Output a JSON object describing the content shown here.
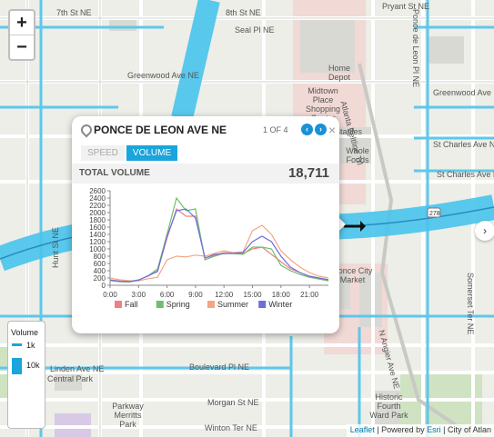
{
  "map": {
    "street_labels": [
      {
        "text": "7th St NE"
      },
      {
        "text": "8th St NE"
      },
      {
        "text": "Pryant St NE"
      },
      {
        "text": "Seal Pl NE"
      },
      {
        "text": "Greenwood Ave NE"
      },
      {
        "text": "Greenwood Ave NE"
      },
      {
        "text": "St Charles Ave NE"
      },
      {
        "text": "St Charles Ave NE"
      },
      {
        "text": "Home Depot"
      },
      {
        "text": "Midtown Place Shopping Center"
      },
      {
        "text": "Staples"
      },
      {
        "text": "Whole Foods"
      },
      {
        "text": "Ponce City Market"
      },
      {
        "text": "Linden Ave NE"
      },
      {
        "text": "Boulevard Pl NE"
      },
      {
        "text": "Morgan St NE"
      },
      {
        "text": "Winton Ter NE"
      },
      {
        "text": "Parkway Merritts Park"
      },
      {
        "text": "Historic Fourth Ward Park"
      },
      {
        "text": "Atlanta Beltline Trl"
      },
      {
        "text": "N Angier Ave NE"
      },
      {
        "text": "Ponce de Leon Pl NE"
      },
      {
        "text": "Somerset Ter NE"
      },
      {
        "text": "Hunt St NE"
      },
      {
        "text": "Central Park"
      }
    ],
    "highway_shield": "278"
  },
  "zoom": {
    "in_label": "+",
    "out_label": "−"
  },
  "popup": {
    "title": "PONCE DE LEON AVE NE",
    "count": "1 OF 4",
    "prev_label": "‹",
    "next_label": "›",
    "close_label": "×",
    "tabs": [
      {
        "label": "SPEED",
        "active": false
      },
      {
        "label": "VOLUME",
        "active": true
      }
    ],
    "total_label": "TOTAL VOLUME",
    "total_value": "18,711"
  },
  "chart_data": {
    "type": "line",
    "x": [
      0,
      1,
      2,
      3,
      4,
      5,
      6,
      7,
      8,
      9,
      10,
      11,
      12,
      13,
      14,
      15,
      16,
      17,
      18,
      19,
      20,
      21,
      22,
      23
    ],
    "x_tick_labels": [
      "0:00",
      "3:00",
      "6:00",
      "9:00",
      "12:00",
      "15:00",
      "18:00",
      "21:00"
    ],
    "x_ticks": [
      0,
      3,
      6,
      9,
      12,
      15,
      18,
      21
    ],
    "ylim": [
      0,
      2600
    ],
    "y_ticks": [
      0,
      200,
      400,
      600,
      800,
      1000,
      1200,
      1400,
      1600,
      1800,
      2000,
      2200,
      2400,
      2600
    ],
    "series": [
      {
        "name": "Fall",
        "color": "#f08080",
        "values": [
          150,
          120,
          100,
          150,
          250,
          400,
          1300,
          2100,
          1900,
          1900,
          750,
          820,
          900,
          880,
          870,
          1000,
          1050,
          850,
          650,
          450,
          350,
          250,
          200,
          150
        ]
      },
      {
        "name": "Spring",
        "color": "#6dbf6d",
        "values": [
          130,
          100,
          90,
          140,
          260,
          450,
          1400,
          2400,
          2050,
          2100,
          700,
          800,
          880,
          870,
          850,
          1050,
          1050,
          1000,
          550,
          400,
          300,
          220,
          170,
          120
        ]
      },
      {
        "name": "Summer",
        "color": "#f4a582",
        "values": [
          200,
          150,
          130,
          120,
          180,
          220,
          700,
          800,
          780,
          830,
          800,
          880,
          950,
          900,
          920,
          1500,
          1650,
          1400,
          950,
          700,
          500,
          350,
          250,
          200
        ]
      },
      {
        "name": "Winter",
        "color": "#6d6de0",
        "values": [
          140,
          110,
          100,
          140,
          260,
          380,
          1350,
          2050,
          2100,
          1850,
          750,
          850,
          870,
          880,
          900,
          1200,
          1350,
          1200,
          800,
          500,
          350,
          250,
          200,
          150
        ]
      }
    ]
  },
  "legend": {
    "title": "Volume",
    "items": [
      {
        "label": "1k"
      },
      {
        "label": "10k"
      }
    ]
  },
  "attribution": {
    "leaflet": "Leaflet",
    "sep1": " | Powered by ",
    "esri": "Esri",
    "sep2": " | City of Atlan"
  }
}
